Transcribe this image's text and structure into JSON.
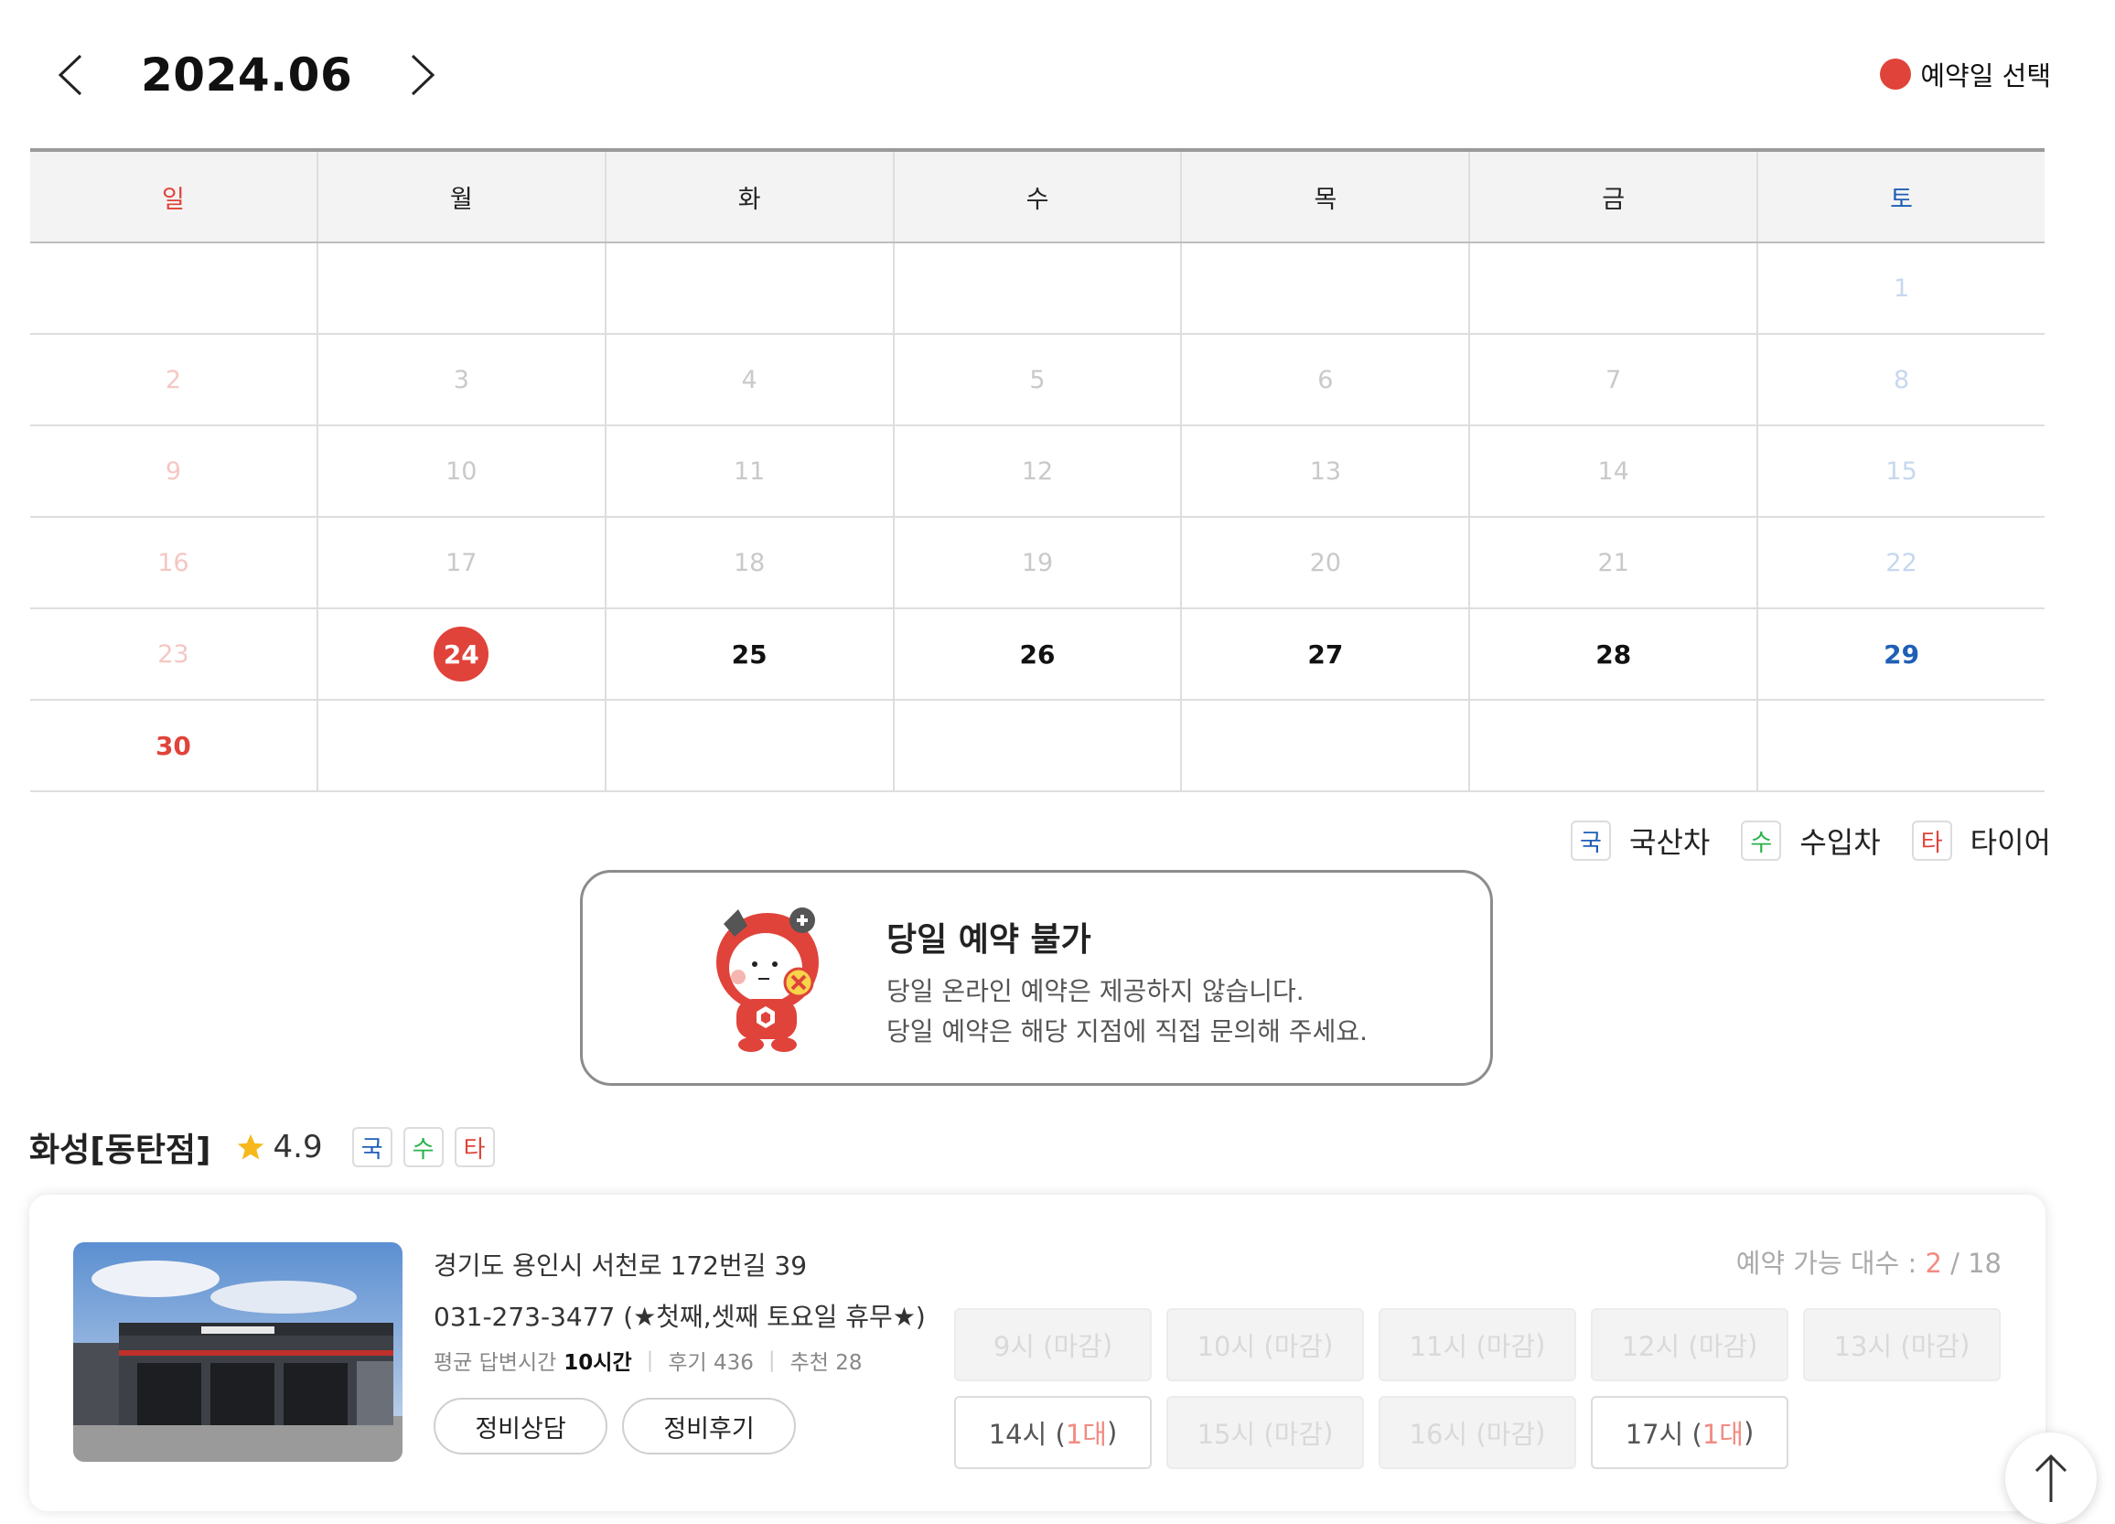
{
  "header": {
    "month_title": "2024.06",
    "prev_label": "<",
    "next_label": ">",
    "legend_selected": "예약일 선택",
    "accent_color": "#e0433a"
  },
  "calendar": {
    "weekdays": [
      "일",
      "월",
      "화",
      "수",
      "목",
      "금",
      "토"
    ],
    "rows": [
      [
        {
          "d": ""
        },
        {
          "d": ""
        },
        {
          "d": ""
        },
        {
          "d": ""
        },
        {
          "d": ""
        },
        {
          "d": ""
        },
        {
          "d": "1",
          "s": "dis"
        }
      ],
      [
        {
          "d": "2",
          "s": "dis"
        },
        {
          "d": "3",
          "s": "dis"
        },
        {
          "d": "4",
          "s": "dis"
        },
        {
          "d": "5",
          "s": "dis"
        },
        {
          "d": "6",
          "s": "dis"
        },
        {
          "d": "7",
          "s": "dis"
        },
        {
          "d": "8",
          "s": "dis"
        }
      ],
      [
        {
          "d": "9",
          "s": "dis"
        },
        {
          "d": "10",
          "s": "dis"
        },
        {
          "d": "11",
          "s": "dis"
        },
        {
          "d": "12",
          "s": "dis"
        },
        {
          "d": "13",
          "s": "dis"
        },
        {
          "d": "14",
          "s": "dis"
        },
        {
          "d": "15",
          "s": "dis"
        }
      ],
      [
        {
          "d": "16",
          "s": "dis"
        },
        {
          "d": "17",
          "s": "dis"
        },
        {
          "d": "18",
          "s": "dis"
        },
        {
          "d": "19",
          "s": "dis"
        },
        {
          "d": "20",
          "s": "dis"
        },
        {
          "d": "21",
          "s": "dis"
        },
        {
          "d": "22",
          "s": "dis"
        }
      ],
      [
        {
          "d": "23",
          "s": "dis"
        },
        {
          "d": "24",
          "s": "sel"
        },
        {
          "d": "25",
          "s": "on"
        },
        {
          "d": "26",
          "s": "on"
        },
        {
          "d": "27",
          "s": "on"
        },
        {
          "d": "28",
          "s": "on"
        },
        {
          "d": "29",
          "s": "on"
        }
      ],
      [
        {
          "d": "30",
          "s": "on"
        },
        {
          "d": ""
        },
        {
          "d": ""
        },
        {
          "d": ""
        },
        {
          "d": ""
        },
        {
          "d": ""
        },
        {
          "d": ""
        }
      ]
    ],
    "selected_date": "24"
  },
  "type_legend": {
    "domestic_badge": "국",
    "domestic_label": "국산차",
    "import_badge": "수",
    "import_label": "수입차",
    "tire_badge": "타",
    "tire_label": "타이어"
  },
  "notice": {
    "title": "당일 예약 불가",
    "line1": "당일 온라인 예약은 제공하지 않습니다.",
    "line2": "당일 예약은 해당 지점에 직접 문의해 주세요."
  },
  "branch": {
    "name": "화성[동탄점]",
    "rating": "4.9",
    "badges": [
      "국",
      "수",
      "타"
    ],
    "address": "경기도 용인시 서천로 172번길 39",
    "phone": "031-273-3477 (★첫째,셋째 토요일 휴무★)",
    "avg_response_label": "평균 답변시간",
    "avg_response_value": "10시간",
    "reviews": "후기 436",
    "recommends": "추천 28",
    "consult_button": "정비상담",
    "review_button": "정비후기",
    "capacity_label": "예약 가능 대수 :",
    "capacity_available": "2",
    "capacity_total": "/ 18",
    "slots": [
      {
        "time": "9시 (",
        "count": "마감",
        ")": ")",
        "open": false
      },
      {
        "time": "10시 (",
        "count": "마감",
        "open": false
      },
      {
        "time": "11시 (",
        "count": "마감",
        "open": false
      },
      {
        "time": "12시 (",
        "count": "마감",
        "open": false
      },
      {
        "time": "13시 (",
        "count": "마감",
        "open": false
      },
      {
        "time": "14시 (",
        "count": "1대",
        "open": true
      },
      {
        "time": "15시 (",
        "count": "마감",
        "open": false
      },
      {
        "time": "16시 (",
        "count": "마감",
        "open": false
      },
      {
        "time": "17시 (",
        "count": "1대",
        "open": true
      }
    ]
  },
  "icons": {
    "prev": "chevron-left-icon",
    "next": "chevron-right-icon",
    "star": "star-icon",
    "scroll_top": "arrow-up-icon"
  }
}
